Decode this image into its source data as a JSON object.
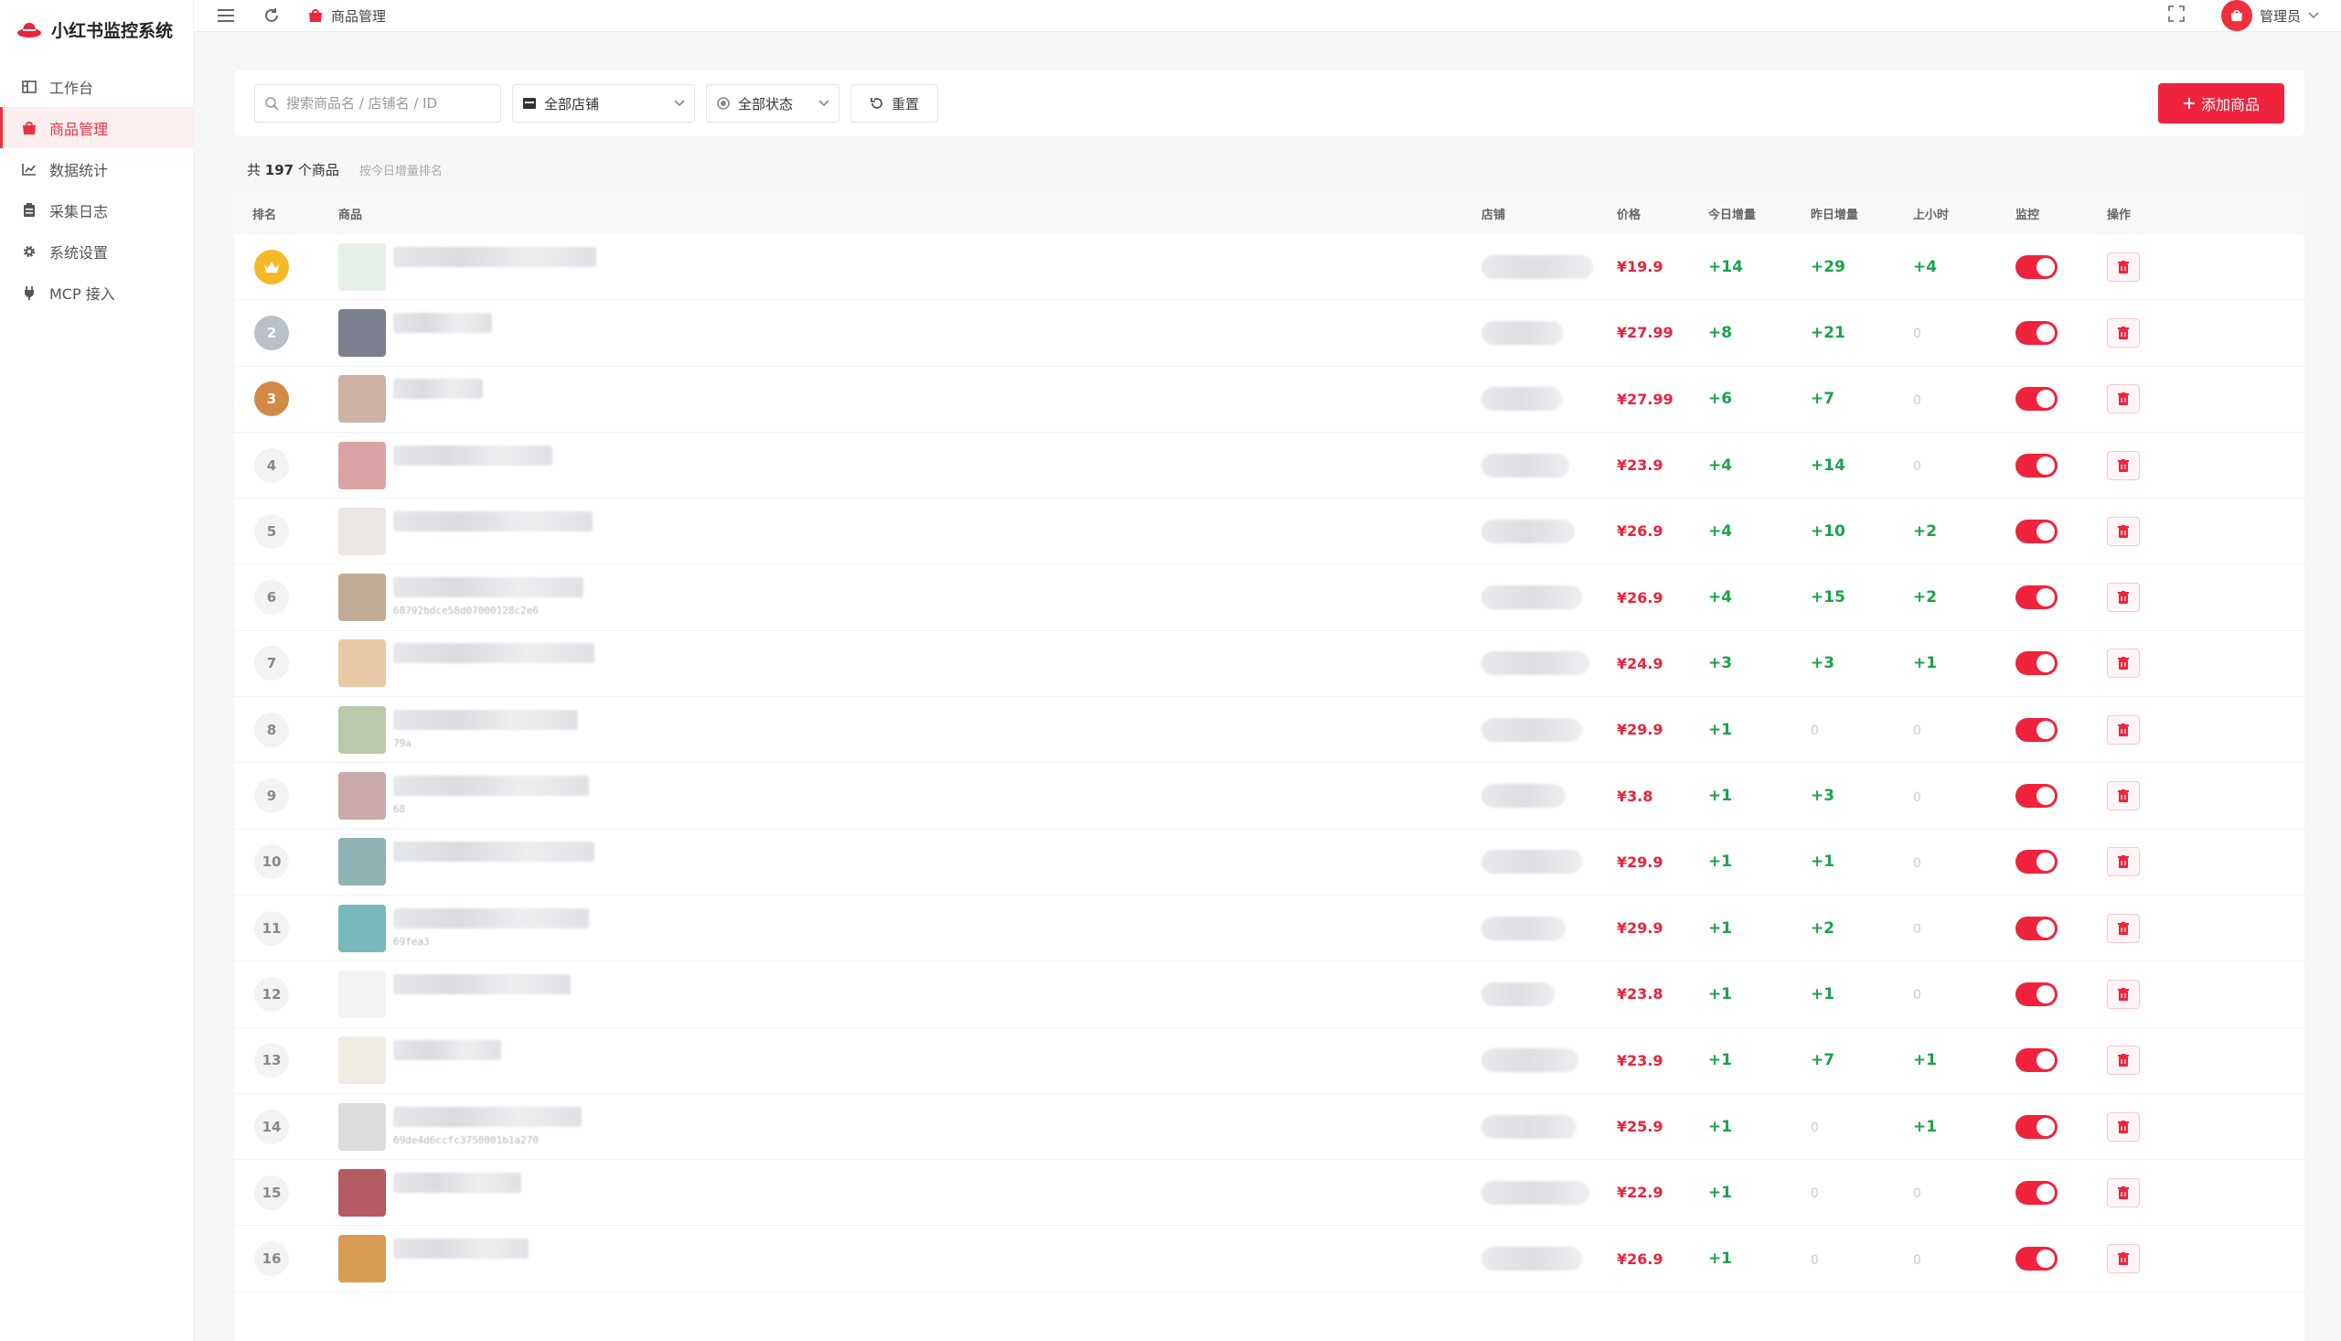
{
  "app": {
    "title": "小红书监控系统"
  },
  "sidebar": {
    "items": [
      {
        "label": "工作台",
        "icon": "dashboard-icon"
      },
      {
        "label": "商品管理",
        "icon": "shop-bag-icon",
        "active": true
      },
      {
        "label": "数据统计",
        "icon": "line-chart-icon"
      },
      {
        "label": "采集日志",
        "icon": "log-icon"
      },
      {
        "label": "系统设置",
        "icon": "gear-icon"
      },
      {
        "label": "MCP 接入",
        "icon": "plug-icon"
      }
    ]
  },
  "topbar": {
    "breadcrumb": "商品管理",
    "user": "管理员"
  },
  "filters": {
    "search_placeholder": "搜索商品名 / 店铺名 / ID",
    "shop_select": "全部店铺",
    "status_select": "全部状态",
    "reset_label": "重置",
    "add_label": "添加商品"
  },
  "summary": {
    "prefix": "共",
    "count": "197",
    "suffix": "个商品",
    "sort_hint": "按今日增量排名"
  },
  "table": {
    "columns": [
      "排名",
      "商品",
      "店铺",
      "价格",
      "今日增量",
      "昨日增量",
      "上小时",
      "监控",
      "操作"
    ],
    "rows": [
      {
        "rank": "",
        "price": "¥19.9",
        "today": "+14",
        "yesterday": "+29",
        "last_hour": "+4",
        "pid": "",
        "thumb": "#e6efe8",
        "name_w": 222,
        "shop_w": 92
      },
      {
        "rank": "2",
        "price": "¥27.99",
        "today": "+8",
        "yesterday": "+21",
        "last_hour": "0",
        "pid": "",
        "thumb": "#7b7f8e",
        "name_w": 108,
        "shop_w": 60
      },
      {
        "rank": "3",
        "price": "¥27.99",
        "today": "+6",
        "yesterday": "+7",
        "last_hour": "0",
        "pid": "",
        "thumb": "#cdb2a4",
        "name_w": 98,
        "shop_w": 58
      },
      {
        "rank": "4",
        "price": "¥23.9",
        "today": "+4",
        "yesterday": "+14",
        "last_hour": "0",
        "pid": "",
        "thumb": "#dba3a3",
        "name_w": 174,
        "shop_w": 66
      },
      {
        "rank": "5",
        "price": "¥26.9",
        "today": "+4",
        "yesterday": "+10",
        "last_hour": "+2",
        "pid": "",
        "thumb": "#ece6e4",
        "name_w": 218,
        "shop_w": 72
      },
      {
        "rank": "6",
        "price": "¥26.9",
        "today": "+4",
        "yesterday": "+15",
        "last_hour": "+2",
        "pid": "68792bdce58d07000128c2e6",
        "thumb": "#c1ab96",
        "name_w": 208,
        "shop_w": 80
      },
      {
        "rank": "7",
        "price": "¥24.9",
        "today": "+3",
        "yesterday": "+3",
        "last_hour": "+1",
        "pid": "",
        "thumb": "#e8c9a6",
        "name_w": 220,
        "shop_w": 88
      },
      {
        "rank": "8",
        "price": "¥29.9",
        "today": "+1",
        "yesterday": "0",
        "last_hour": "0",
        "pid": "79a",
        "thumb": "#b9c9a9",
        "name_w": 202,
        "shop_w": 80
      },
      {
        "rank": "9",
        "price": "¥3.8",
        "today": "+1",
        "yesterday": "+3",
        "last_hour": "0",
        "pid": "68",
        "thumb": "#c9a9a9",
        "name_w": 214,
        "shop_w": 62
      },
      {
        "rank": "10",
        "price": "¥29.9",
        "today": "+1",
        "yesterday": "+1",
        "last_hour": "0",
        "pid": "",
        "thumb": "#8fb3b5",
        "name_w": 220,
        "shop_w": 80
      },
      {
        "rank": "11",
        "price": "¥29.9",
        "today": "+1",
        "yesterday": "+2",
        "last_hour": "0",
        "pid": "69fea3",
        "thumb": "#79b8bc",
        "name_w": 214,
        "shop_w": 62
      },
      {
        "rank": "12",
        "price": "¥23.8",
        "today": "+1",
        "yesterday": "+1",
        "last_hour": "0",
        "pid": "",
        "thumb": "#f3f3f2",
        "name_w": 194,
        "shop_w": 50
      },
      {
        "rank": "13",
        "price": "¥23.9",
        "today": "+1",
        "yesterday": "+7",
        "last_hour": "+1",
        "pid": "",
        "thumb": "#efece4",
        "name_w": 118,
        "shop_w": 76
      },
      {
        "rank": "14",
        "price": "¥25.9",
        "today": "+1",
        "yesterday": "0",
        "last_hour": "+1",
        "pid": "69de4d6ccfc3750001b1a270",
        "thumb": "#dcdcdf",
        "name_w": 206,
        "shop_w": 74
      },
      {
        "rank": "15",
        "price": "¥22.9",
        "today": "+1",
        "yesterday": "0",
        "last_hour": "0",
        "pid": "",
        "thumb": "#b35a63",
        "name_w": 140,
        "shop_w": 88
      },
      {
        "rank": "16",
        "price": "¥26.9",
        "today": "+1",
        "yesterday": "0",
        "last_hour": "0",
        "pid": "",
        "thumb": "#d79b54",
        "name_w": 148,
        "shop_w": 80
      }
    ]
  },
  "colors": {
    "accent": "#f0233c",
    "positive": "#1aa34a",
    "price": "#e8233b",
    "gold": "#f7b928",
    "silver": "#b9c0cc",
    "bronze": "#d18945"
  }
}
